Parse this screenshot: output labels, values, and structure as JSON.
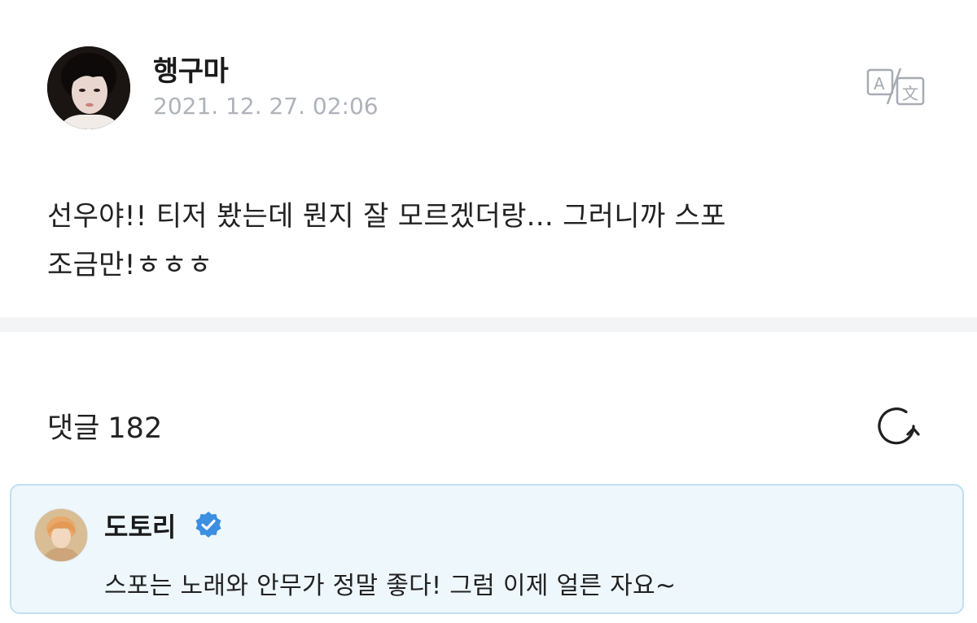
{
  "post": {
    "author_name": "행구마",
    "timestamp": "2021. 12. 27. 02:06",
    "body_line1": "선우야!! 티저 봤는데 뭔지 잘 모르겠더랑... 그러니까 스포",
    "body_line2": "조금만!ㅎㅎㅎ",
    "avatar_icon": "user-avatar-photo",
    "translate_icon": "translate-icon"
  },
  "comments": {
    "label": "댓글",
    "count": "182",
    "refresh_icon": "refresh-icon"
  },
  "highlighted_comment": {
    "author_name": "도토리",
    "verified_icon": "verified-badge-icon",
    "text": "스포는 노래와 안무가 정말 좋다! 그럼 이제 얼른 자요~"
  },
  "colors": {
    "accent_blue": "#3b8ee0",
    "comment_bg": "#eef7fc",
    "comment_border": "#bfe0f2",
    "muted_text": "#aeb3bb"
  }
}
